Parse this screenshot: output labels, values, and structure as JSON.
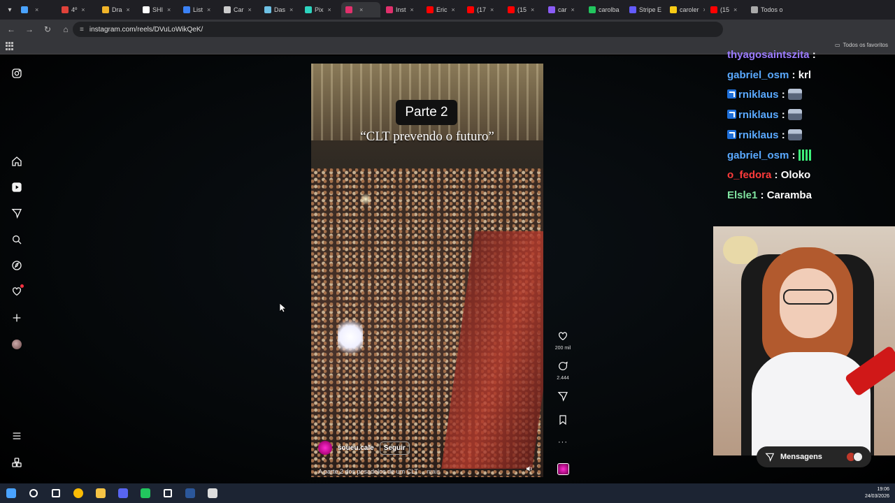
{
  "browser": {
    "tabs": [
      {
        "label": "",
        "color": "#4aa3ff"
      },
      {
        "label": "4º",
        "color": "#e0423a"
      },
      {
        "label": "Dra",
        "color": "#f0b429"
      },
      {
        "label": "SHI",
        "color": "#ffffff"
      },
      {
        "label": "List",
        "color": "#3b82f6"
      },
      {
        "label": "Car",
        "color": "#cccccc"
      },
      {
        "label": "Das",
        "color": "#6ec1e4"
      },
      {
        "label": "Pix",
        "color": "#2dd4bf"
      },
      {
        "label": "",
        "color": "#e1306c",
        "active": true
      },
      {
        "label": "Inst",
        "color": "#e1306c"
      },
      {
        "label": "Eric",
        "color": "#ff0000"
      },
      {
        "label": "(17",
        "color": "#ff0000"
      },
      {
        "label": "(15",
        "color": "#ff0000"
      },
      {
        "label": "car",
        "color": "#8b5cf6"
      },
      {
        "label": "carolba",
        "color": "#22c55e"
      },
      {
        "label": "Stripe E",
        "color": "#635bff"
      },
      {
        "label": "caroler",
        "color": "#facc15"
      },
      {
        "label": "(15",
        "color": "#ff0000"
      },
      {
        "label": "Todos o",
        "color": "#aaaaaa"
      }
    ],
    "url": "instagram.com/reels/DVuLoWikQeK/",
    "favorites_label": "Todos os favoritos"
  },
  "reel": {
    "overlay_title": "Parte 2",
    "overlay_quote": "“CLT prevendo o futuro”",
    "author": "soueu.cale",
    "follow_label": "Seguir",
    "description": "A parte 2 dos pesadelos de um CLT ...",
    "more_label": "mais",
    "likes": "200 mil",
    "comments": "2.444"
  },
  "chat": [
    {
      "user": "thyagosaintszita",
      "color": "#9b7bff",
      "text": "",
      "badge": false,
      "emote": ""
    },
    {
      "user": "gabriel_osm",
      "color": "#5aa9ff",
      "text": "krl",
      "badge": false,
      "emote": ""
    },
    {
      "user": "rniklaus",
      "color": "#5aa9ff",
      "text": "",
      "badge": true,
      "emote": "train"
    },
    {
      "user": "rniklaus",
      "color": "#5aa9ff",
      "text": "",
      "badge": true,
      "emote": "train"
    },
    {
      "user": "rniklaus",
      "color": "#5aa9ff",
      "text": "",
      "badge": true,
      "emote": "train"
    },
    {
      "user": "gabriel_osm",
      "color": "#5aa9ff",
      "text": "",
      "badge": false,
      "emote": "eq"
    },
    {
      "user": "o_fedora",
      "color": "#ff3b3b",
      "text": "Oloko",
      "badge": false,
      "emote": ""
    },
    {
      "user": "Elsle1",
      "color": "#7fe3a0",
      "text": "Caramba",
      "badge": false,
      "emote": ""
    }
  ],
  "messages_label": "Mensagens",
  "taskbar": {
    "time": "19:06",
    "date": "24/03/2026",
    "apps": [
      {
        "name": "windows-start-icon",
        "color": "#4aa3ff"
      },
      {
        "name": "search-icon",
        "color": "#ffffff"
      },
      {
        "name": "task-view-icon",
        "color": "#ffffff"
      },
      {
        "name": "chrome-icon",
        "color": "#fbbc05"
      },
      {
        "name": "file-explorer-icon",
        "color": "#f6c445"
      },
      {
        "name": "discord-icon",
        "color": "#5865f2"
      },
      {
        "name": "xbox-icon",
        "color": "#22c55e"
      },
      {
        "name": "defender-icon",
        "color": "#ffffff"
      },
      {
        "name": "word-icon",
        "color": "#2b579a"
      },
      {
        "name": "obs-icon",
        "color": "#dddddd"
      }
    ]
  }
}
